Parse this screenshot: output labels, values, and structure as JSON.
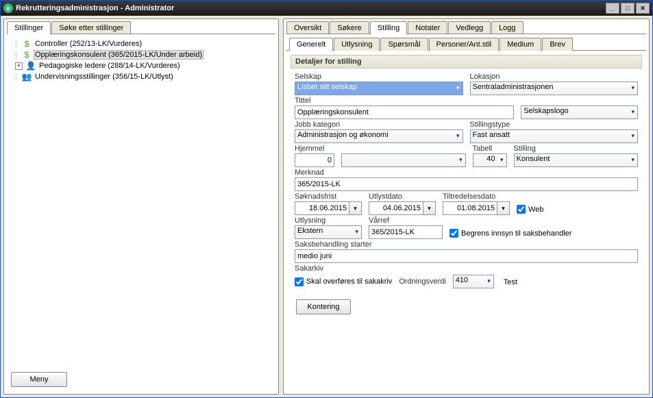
{
  "window": {
    "title": "Rekrutteringsadministrasjon - Administrator"
  },
  "left_tabs": [
    {
      "label": "Stillinger",
      "active": true
    },
    {
      "label": "Søke etter stillinger",
      "active": false
    }
  ],
  "tree": [
    {
      "label": "Controller (252/13-LK/Vurderes)",
      "icon": "$",
      "indent": 1,
      "expander": ""
    },
    {
      "label": "Opplæringskonsulent (365/2015-LK/Under arbeid)",
      "icon": "$",
      "indent": 1,
      "selected": true,
      "expander": ""
    },
    {
      "label": "Pedagogiske ledere (288/14-LK/Vurderes)",
      "icon": "👤",
      "indent": 1,
      "expander": "+"
    },
    {
      "label": "Undervisningsstillinger (356/15-LK/Utlyst)",
      "icon": "👥",
      "indent": 1,
      "expander": ""
    }
  ],
  "meny_btn": "Meny",
  "right_tabs": [
    {
      "label": "Oversikt"
    },
    {
      "label": "Søkere"
    },
    {
      "label": "Stilling",
      "active": true
    },
    {
      "label": "Notater"
    },
    {
      "label": "Vedlegg"
    },
    {
      "label": "Logg"
    }
  ],
  "subtabs": [
    {
      "label": "Generelt",
      "active": true
    },
    {
      "label": "Utlysning"
    },
    {
      "label": "Spørsmål"
    },
    {
      "label": "Personer/Ant.stil"
    },
    {
      "label": "Medium"
    },
    {
      "label": "Brev"
    }
  ],
  "section_title": "Detaljer for stilling",
  "form": {
    "selskap_lbl": "Selskap",
    "selskap": "Lisbet sitt selskap",
    "lokasjon_lbl": "Lokasjon",
    "lokasjon": "Sentraladministrasjonen",
    "tittel_lbl": "Tittel",
    "tittel": "Opplæringskonsulent",
    "logo": "Selskapslogo",
    "jobbkat_lbl": "Jobb kategori",
    "jobbkat": "Administrasjon og økonomi",
    "stiltype_lbl": "Stillingstype",
    "stiltype": "Fast ansatt",
    "hjemmel_lbl": "Hjemmel",
    "hjemmel_num": "0",
    "hjemmel_sel": "",
    "tabell_lbl": "Tabell",
    "tabell": "40",
    "stilling_lbl": "Stilling",
    "stilling": "Konsulent",
    "merknad_lbl": "Merknad",
    "merknad": "365/2015-LK",
    "soknadsfrist_lbl": "Søknadsfrist",
    "soknadsfrist": "18.06.2015",
    "utlystdato_lbl": "Utlystdato",
    "utlystdato": "04.06.2015",
    "tiltredelse_lbl": "Tiltredelsesdato",
    "tiltredelse": "01.08.2015",
    "web_lbl": "Web",
    "utlysning_lbl": "Utlysning",
    "utlysning": "Ekstern",
    "varref_lbl": "Vårref",
    "varref": "365/2015-LK",
    "begrens_lbl": "Begrens innsyn til saksbehandler",
    "saksbehandling_lbl": "Saksbehandling starter",
    "saksbehandling": "medio juni",
    "sakarkiv_lbl": "Sakarkiv",
    "skal_overfores_lbl": "Skal overføres til sakakriv",
    "ordningsverdi_lbl": "Ordningsverdi",
    "ordningsverdi": "410",
    "ordningsverdi_text": "Test",
    "kontering_btn": "Kontering"
  }
}
